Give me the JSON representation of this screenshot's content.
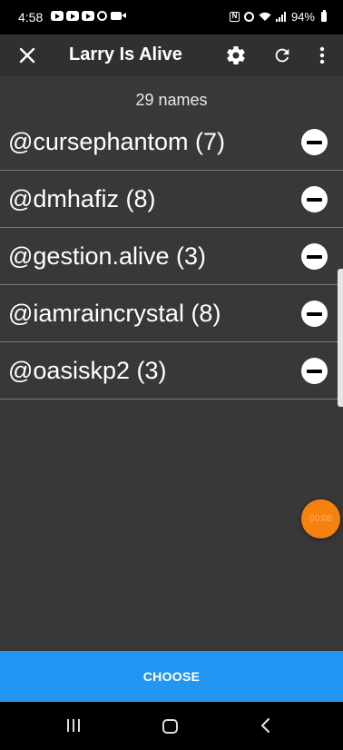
{
  "status_bar": {
    "time": "4:58",
    "battery": "94%"
  },
  "app_bar": {
    "title": "Larry Is Alive"
  },
  "names_count": "29 names",
  "names": [
    "@cursephantom (7)",
    "@dmhafiz (8)",
    "@gestion.alive (3)",
    "@iamraincrystal (8)",
    "@oasiskp2 (3)"
  ],
  "timer": {
    "label": "00:00"
  },
  "choose_label": "CHOOSE",
  "icons": {
    "close": "close-icon",
    "settings": "gear-icon",
    "refresh": "refresh-icon",
    "more": "more-vert-icon",
    "remove": "remove-circle-icon",
    "nav_recent": "recent-apps-icon",
    "nav_home": "home-icon",
    "nav_back": "back-icon"
  },
  "colors": {
    "background": "#383838",
    "app_bar": "#303030",
    "accent": "#2196f3",
    "fab": "#f5810f"
  }
}
